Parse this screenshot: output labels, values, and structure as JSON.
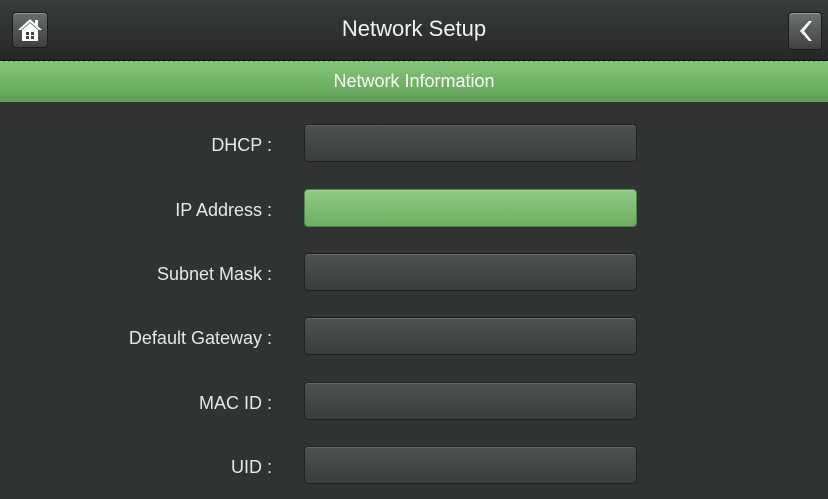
{
  "header": {
    "title": "Network Setup"
  },
  "section": {
    "title": "Network Information"
  },
  "fields": [
    {
      "label": "DHCP :",
      "value": ""
    },
    {
      "label": "IP Address :",
      "value": ""
    },
    {
      "label": "Subnet Mask :",
      "value": ""
    },
    {
      "label": "Default Gateway :",
      "value": ""
    },
    {
      "label": "MAC ID :",
      "value": ""
    },
    {
      "label": "UID :",
      "value": ""
    }
  ],
  "colors": {
    "accent_green": "#6fb264",
    "background": "#313232"
  },
  "icons": {
    "home": "home-icon",
    "back": "chevron-left-icon"
  }
}
